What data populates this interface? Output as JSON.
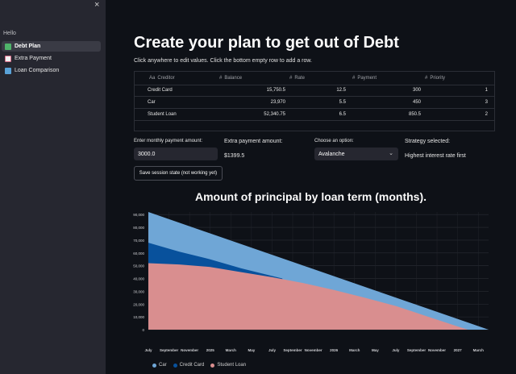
{
  "sidebar": {
    "heading": "Hello",
    "items": [
      {
        "label": "Debt Plan",
        "icon": "money-with-wings-icon",
        "active": true,
        "icon_color": "#4fb36a"
      },
      {
        "label": "Extra Payment",
        "icon": "chart-increasing-icon",
        "active": false,
        "icon_color": "#d96e8a"
      },
      {
        "label": "Loan Comparison",
        "icon": "bar-chart-icon",
        "active": false,
        "icon_color": "#5aa3d9"
      }
    ],
    "close_label": "×"
  },
  "main": {
    "title": "Create your plan to get out of Debt",
    "subtitle": "Click anywhere to edit values. Click the bottom empty row to add a row."
  },
  "table": {
    "columns": [
      "Creditor",
      "Balance",
      "Rate",
      "Payment",
      "Priority"
    ],
    "rows": [
      [
        "Credit Card",
        "15,750.5",
        "12.5",
        "300",
        "1"
      ],
      [
        "Car",
        "23,970",
        "5.5",
        "450",
        "3"
      ],
      [
        "Student Loan",
        "52,340.75",
        "6.5",
        "850.5",
        "2"
      ]
    ]
  },
  "form": {
    "monthly_payment_label": "Enter monthly payment amount:",
    "monthly_payment_value": "3000.0",
    "extra_payment_label": "Extra payment amount:",
    "extra_payment_value": "$1399.5",
    "option_label": "Choose an option:",
    "option_value": "Avalanche",
    "strategy_label": "Strategy selected:",
    "strategy_value": "Highest interest rate first",
    "save_button": "Save session state (not working yet)"
  },
  "colors": {
    "car": "#6fa6d6",
    "credit_card": "#08519c",
    "student_loan": "#d98e8f",
    "background": "#0e1117",
    "sidebar": "#262730"
  },
  "chart_data": {
    "type": "area",
    "title": "Amount of principal by loan term (months).",
    "stacked": false,
    "x_ticks": [
      "July",
      "September",
      "November",
      "2025",
      "March",
      "May",
      "July",
      "September",
      "November",
      "2026",
      "March",
      "May",
      "July",
      "September",
      "November",
      "2027",
      "March"
    ],
    "y_ticks": [
      "90,000",
      "80,000",
      "70,000",
      "60,000",
      "50,000",
      "40,000",
      "30,000",
      "20,000",
      "10,000",
      "0"
    ],
    "ylim": [
      0,
      92000
    ],
    "x_range_months": [
      0,
      33
    ],
    "series": [
      {
        "name": "Car",
        "points": [
          [
            0,
            92000
          ],
          [
            33,
            0
          ]
        ]
      },
      {
        "name": "Credit Card",
        "points": [
          [
            0,
            68000
          ],
          [
            3,
            61000
          ],
          [
            6,
            55000
          ],
          [
            9,
            48000
          ],
          [
            12,
            42000
          ],
          [
            13,
            40000
          ]
        ]
      },
      {
        "name": "Student Loan",
        "points": [
          [
            0,
            52000
          ],
          [
            3,
            51000
          ],
          [
            6,
            49000
          ],
          [
            9,
            45000
          ],
          [
            12,
            41000
          ],
          [
            15,
            36500
          ],
          [
            18,
            31000
          ],
          [
            21,
            25000
          ],
          [
            24,
            18500
          ],
          [
            27,
            10500
          ],
          [
            30,
            2500
          ],
          [
            31,
            0
          ]
        ]
      }
    ],
    "legend": [
      "Car",
      "Credit Card",
      "Student Loan"
    ],
    "legend_position": "bottom-left",
    "grid": true
  }
}
